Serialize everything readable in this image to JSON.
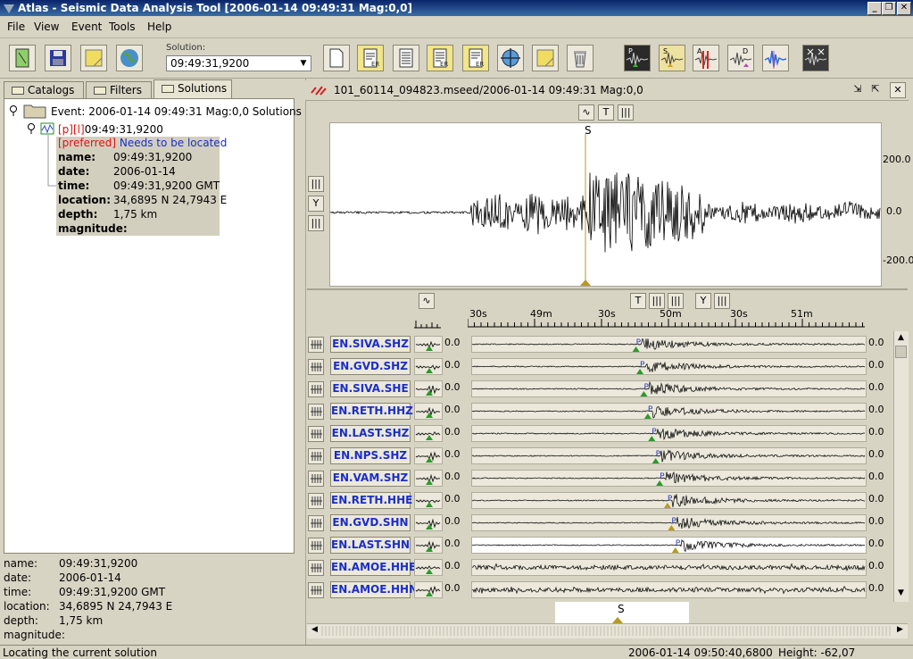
{
  "window": {
    "title": "Atlas - Seismic Data Analysis Tool [2006-01-14 09:49:31 Mag:0,0]",
    "controls": [
      "_",
      "❐",
      "✕"
    ]
  },
  "menu": [
    "File",
    "View",
    "Event",
    "Tools",
    "Help"
  ],
  "toolbar": {
    "solution_label": "Solution:",
    "solution_value": "09:49:31,9200",
    "left_icons": [
      "document-icon",
      "save-icon",
      "note-icon",
      "globe-icon"
    ],
    "right_icons": [
      "blank-page-icon",
      "report-icon",
      "list-icon",
      "report-list-icon",
      "report-selected-icon",
      "target-icon",
      "note-icon",
      "trash-icon"
    ],
    "filter_icons": [
      "p-pick-icon",
      "s-pick-icon",
      "a-pick-icon",
      "d-pick-icon",
      "waveform-blue-icon",
      "x-pick-icon"
    ]
  },
  "left_tabs": [
    {
      "label": "Catalogs",
      "active": false
    },
    {
      "label": "Filters",
      "active": false
    },
    {
      "label": "Solutions",
      "active": true
    }
  ],
  "tree": {
    "event_label": "Event: 2006-01-14 09:49:31 Mag:0,0 Solutions",
    "solution_prefix": "[p][l]",
    "solution_time": "09:49:31,9200",
    "preferred": "[preferred]",
    "status": "Needs to be located"
  },
  "info": {
    "name_k": "name:",
    "name_v": "09:49:31,9200",
    "date_k": "date:",
    "date_v": "2006-01-14",
    "time_k": "time:",
    "time_v": "09:49:31,9200 GMT",
    "location_k": "location:",
    "location_v": "34,6895 N 24,7943 E",
    "depth_k": "depth:",
    "depth_v": "1,75 km",
    "magnitude_k": "magnitude:",
    "magnitude_v": ""
  },
  "details": {
    "name_k": "name:",
    "name_v": "09:49:31,9200",
    "date_k": "date:",
    "date_v": "2006-01-14",
    "time_k": "time:",
    "time_v": "09:49:31,9200 GMT",
    "location_k": "location:",
    "location_v": "34,6895 N 24,7943 E",
    "depth_k": "depth:",
    "depth_v": "1,75 km",
    "magnitude_k": "magnitude:",
    "magnitude_v": ""
  },
  "waveform_panel": {
    "title": "101_60114_094823.mseed/2006-01-14 09:49:31 Mag:0,0",
    "top_buttons": [
      "∿",
      "T",
      "|||"
    ],
    "side_buttons": [
      "|||",
      "Y",
      "|||"
    ],
    "pick_label": "S",
    "y_labels": [
      "200.0",
      "0.0",
      "-200.0"
    ]
  },
  "time_axis": {
    "labels": [
      "30s",
      "49m",
      "30s",
      "50m",
      "30s",
      "51m"
    ],
    "buttons": [
      "∿",
      "T",
      "|||",
      "|||",
      "Y",
      "|||"
    ]
  },
  "channels": [
    {
      "name": "EN.SIVA.SHZ",
      "zero": "0.0"
    },
    {
      "name": "EN.GVD.SHZ",
      "zero": "0.0"
    },
    {
      "name": "EN.SIVA.SHE",
      "zero": "0.0"
    },
    {
      "name": "EN.RETH.HHZ",
      "zero": "0.0"
    },
    {
      "name": "EN.LAST.SHZ",
      "zero": "0.0"
    },
    {
      "name": "EN.NPS.SHZ",
      "zero": "0.0"
    },
    {
      "name": "EN.VAM.SHZ",
      "zero": "0.0"
    },
    {
      "name": "EN.RETH.HHE",
      "zero": "0.0"
    },
    {
      "name": "EN.GVD.SHN",
      "zero": "0.0"
    },
    {
      "name": "EN.LAST.SHN",
      "zero": "0.0"
    },
    {
      "name": "EN.AMOE.HHE",
      "zero": "0.0"
    },
    {
      "name": "EN.AMOE.HHN",
      "zero": "0.0"
    }
  ],
  "bottom_pick_label": "S",
  "status": {
    "message": "Locating the current solution",
    "time": "2006-01-14 09:50:40,6800",
    "height": "Height: -62,07"
  },
  "colors": {
    "accent": "#1a2ec8",
    "preferred": "#e01010",
    "pick_line": "#b89a20",
    "pick_marker": "#2a9a2a"
  }
}
